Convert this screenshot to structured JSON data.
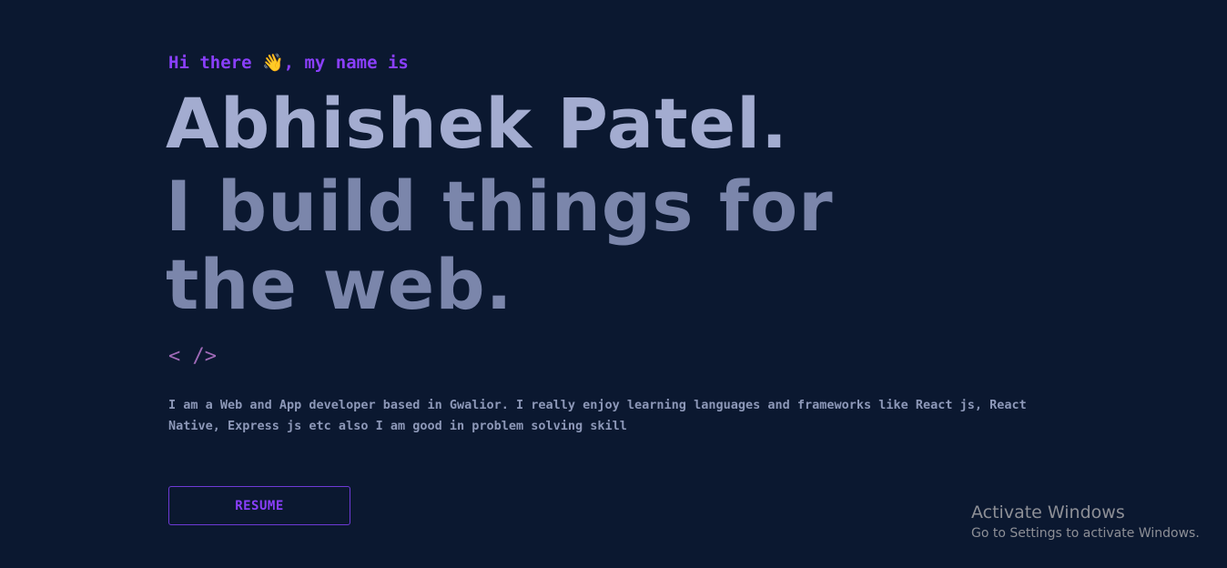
{
  "hero": {
    "greeting": "Hi there 👋, my name is",
    "name": "Abhishek Patel.",
    "tagline": "I build things for the web.",
    "code_symbol": "< />",
    "bio": "I am a Web and App developer based in Gwalior. I really enjoy learning languages and frameworks like React js, React Native, Express js etc also I am good in problem solving skill"
  },
  "actions": {
    "resume_label": "RESUME"
  },
  "os_watermark": {
    "title": "Activate Windows",
    "subtitle": "Go to Settings to activate Windows."
  },
  "colors": {
    "background": "#0b1830",
    "accent": "#8a3ffc",
    "name": "#a3acd0",
    "tagline": "#7b86ab",
    "body_text": "#8d98b8"
  },
  "icons": {
    "code": "code-icon"
  }
}
